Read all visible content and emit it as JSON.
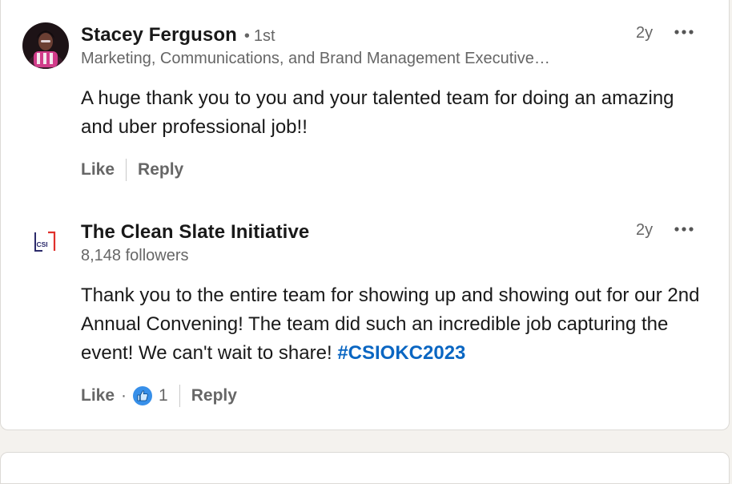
{
  "comments": [
    {
      "author": "Stacey Ferguson",
      "connection_separator": "•",
      "connection": "1st",
      "headline": "Marketing, Communications, and Brand Management Executive…",
      "time": "2y",
      "text": "A huge thank you to you and your talented team for doing an amazing and uber professional job!!",
      "like_label": "Like",
      "reply_label": "Reply",
      "avatar_icon": "profile-photo"
    },
    {
      "author": "The Clean Slate Initiative",
      "followers": "8,148 followers",
      "time": "2y",
      "text": "Thank you to the entire team for showing up and showing out for our 2nd Annual Convening! The team did such an incredible job capturing the event! We can't wait to share!",
      "hashtag": "#CSIOKC2023",
      "like_label": "Like",
      "reaction_separator": "·",
      "reaction_icon": "thumbs-up-icon",
      "reaction_count": "1",
      "reply_label": "Reply",
      "logo_text": "CSI"
    }
  ],
  "colors": {
    "link": "#0a66c2",
    "secondary_text": "#666666",
    "like_badge": "#378fe9",
    "logo_red": "#e0302b",
    "logo_navy": "#2b2a6b"
  }
}
